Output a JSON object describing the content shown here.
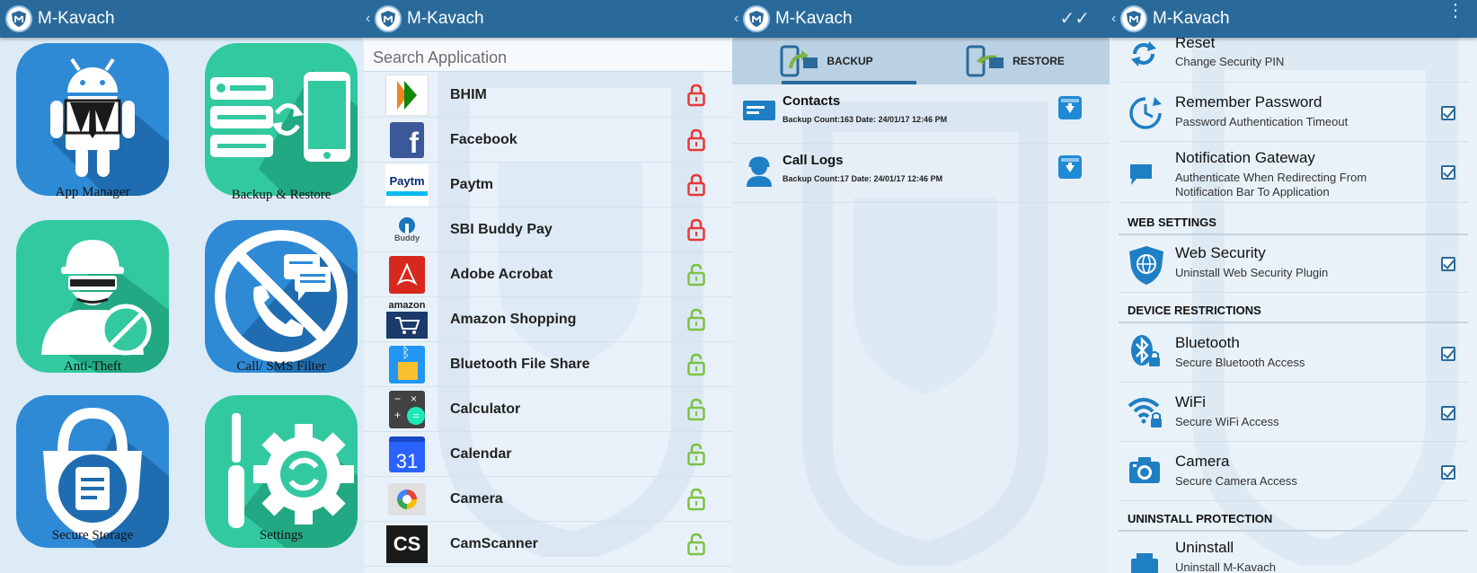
{
  "app_title": "M-Kavach",
  "colors": {
    "topbar": "#2a6a9b",
    "tile_blue": "#2f8ad6",
    "tile_green": "#33c9a0",
    "lock_red": "#e53935",
    "lock_green": "#7cc242"
  },
  "home": {
    "tiles": [
      {
        "label": "App Manager",
        "icon": "android-agent-icon"
      },
      {
        "label": "Backup & Restore",
        "icon": "backup-phone-icon"
      },
      {
        "label": "Anti-Theft",
        "icon": "thief-icon"
      },
      {
        "label": "Call/ SMS Filter",
        "icon": "call-block-icon"
      },
      {
        "label": "Secure Storage",
        "icon": "lock-document-icon"
      },
      {
        "label": "Settings",
        "icon": "tools-gear-icon"
      }
    ]
  },
  "app_manager": {
    "search_placeholder": "Search Application",
    "apps": [
      {
        "name": "BHIM",
        "locked": true,
        "lock_color": "#e53935"
      },
      {
        "name": "Facebook",
        "locked": true,
        "lock_color": "#e53935"
      },
      {
        "name": "Paytm",
        "locked": true,
        "lock_color": "#e53935"
      },
      {
        "name": "SBI Buddy Pay",
        "locked": true,
        "lock_color": "#e53935"
      },
      {
        "name": "Adobe Acrobat",
        "locked": false,
        "lock_color": "#7cc242"
      },
      {
        "name": "Amazon Shopping",
        "locked": false,
        "lock_color": "#7cc242"
      },
      {
        "name": "Bluetooth File Share",
        "locked": false,
        "lock_color": "#7cc242"
      },
      {
        "name": "Calculator",
        "locked": false,
        "lock_color": "#7cc242"
      },
      {
        "name": "Calendar",
        "locked": false,
        "lock_color": "#7cc242"
      },
      {
        "name": "Camera",
        "locked": false,
        "lock_color": "#7cc242"
      },
      {
        "name": "CamScanner",
        "locked": false,
        "lock_color": "#7cc242"
      }
    ],
    "icon_text": {
      "paytm": "Paytm",
      "buddy": "Buddy",
      "amazon": "amazon",
      "calendar": "31",
      "camscanner": "CS"
    }
  },
  "backup": {
    "tabs": [
      {
        "label": "BACKUP",
        "active": true
      },
      {
        "label": "RESTORE",
        "active": false
      }
    ],
    "items": [
      {
        "title": "Contacts",
        "meta": "Backup Count:163   Date: 24/01/17 12:46 PM"
      },
      {
        "title": "Call Logs",
        "meta": "Backup Count:17   Date: 24/01/17 12:46 PM"
      }
    ]
  },
  "settings": {
    "rows": [
      {
        "title": "Reset",
        "sub": "Change Security PIN",
        "checked": false
      },
      {
        "title": "Remember Password",
        "sub": "Password Authentication Timeout",
        "checked": true
      },
      {
        "title": "Notification Gateway",
        "sub": "Authenticate When Redirecting From Notification Bar To Application",
        "checked": true
      },
      {
        "title": "Web Security",
        "sub": "Uninstall Web Security Plugin",
        "checked": true
      },
      {
        "title": "Bluetooth",
        "sub": "Secure Bluetooth Access",
        "checked": true
      },
      {
        "title": "WiFi",
        "sub": "Secure WiFi Access",
        "checked": true
      },
      {
        "title": "Camera",
        "sub": "Secure Camera Access",
        "checked": true
      },
      {
        "title": "Uninstall",
        "sub": "Uninstall M-Kavach",
        "checked": false
      }
    ],
    "sections": [
      "WEB SETTINGS",
      "DEVICE RESTRICTIONS",
      "UNINSTALL PROTECTION"
    ]
  }
}
